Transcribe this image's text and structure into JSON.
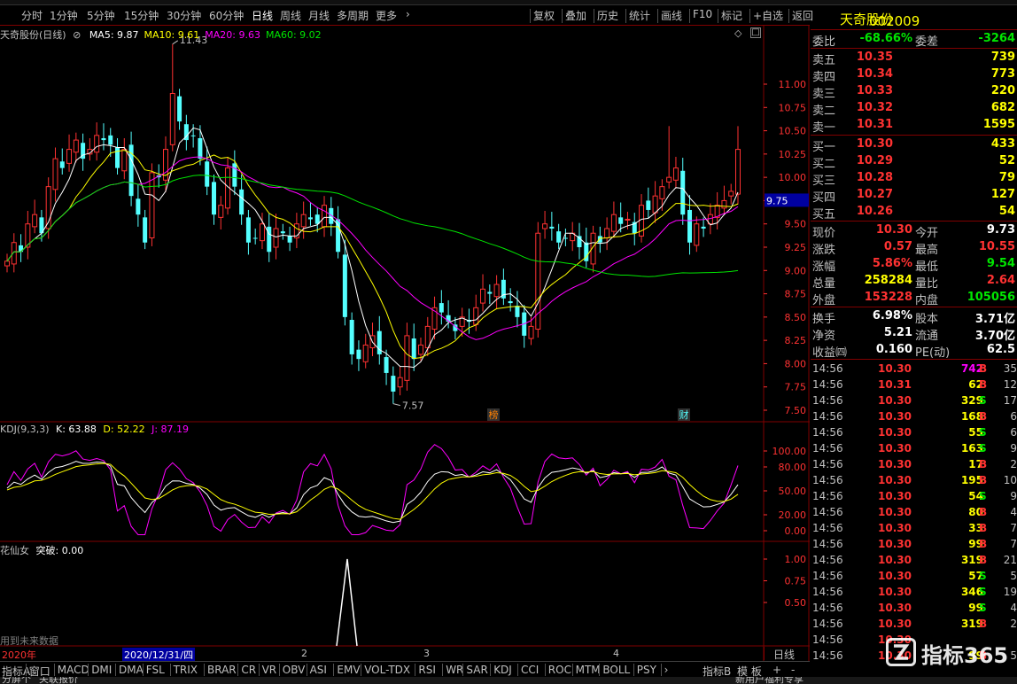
{
  "toolbar": {
    "periods": [
      "分时",
      "1分钟",
      "5分钟",
      "15分钟",
      "30分钟",
      "60分钟",
      "日线",
      "周线",
      "月线",
      "多周期",
      "更多"
    ],
    "active": "日线",
    "actions": [
      "复权",
      "叠加",
      "历史",
      "统计",
      "画线",
      "F10",
      "标记",
      "+自选",
      "返回"
    ]
  },
  "stock": {
    "code": "002009",
    "name": "天奇股份"
  },
  "main_chart": {
    "title": "天奇股份(日线)",
    "ma": [
      {
        "label": "MA5: 9.87",
        "color": "#ffffff"
      },
      {
        "label": "MA10: 9.61",
        "color": "#ffff00"
      },
      {
        "label": "MA20: 9.63",
        "color": "#ff00ff"
      },
      {
        "label": "MA60: 9.02",
        "color": "#00e600"
      }
    ],
    "high_label": "11.43",
    "low_label": "7.57",
    "current_price_tag": "9.75",
    "markers": [
      "榜",
      "财"
    ],
    "y_ticks": [
      "11.00",
      "10.75",
      "10.50",
      "10.25",
      "10.00",
      "9.75",
      "9.50",
      "9.25",
      "9.00",
      "8.75",
      "8.50",
      "8.25",
      "8.00",
      "7.75",
      "7.50"
    ]
  },
  "kdj": {
    "title": "KDJ(9,3,3)",
    "k": "K: 63.88",
    "d": "D: 52.22",
    "j": "J: 87.19",
    "y_ticks": [
      "100.00",
      "80.00",
      "50.00",
      "20.00",
      "0.00"
    ]
  },
  "hxn": {
    "title": "花仙女",
    "value": "突破: 0.00",
    "y_ticks": [
      "1.00",
      "0.75",
      "0.50"
    ],
    "note": "用到未来数据"
  },
  "date_axis": {
    "year": "2020年",
    "cursor_date": "2020/12/31/四",
    "months": [
      "2",
      "3",
      "4"
    ],
    "period": "日线"
  },
  "indicator_tabs": [
    "指标A",
    "窗口",
    "MACD",
    "DMI",
    "DMA",
    "FSL",
    "TRIX",
    "BRAR",
    "CR",
    "VR",
    "OBV",
    "ASI",
    "EMV",
    "VOL-TDX",
    "RSI",
    "WR",
    "SAR",
    "KDJ",
    "CCI",
    "ROC",
    "MTM",
    "BOLL",
    "PSY"
  ],
  "bottom_right_tabs": [
    "指标B",
    "模 板",
    "+",
    "-"
  ],
  "status_left": [
    "分屏个",
    "关联报价"
  ],
  "status_right": "新用户福利专享",
  "quote": {
    "weibi": {
      "label": "委比",
      "value": "-68.66%",
      "label2": "委差",
      "value2": "-3264"
    },
    "sell": [
      {
        "label": "卖五",
        "price": "10.35",
        "vol": "739"
      },
      {
        "label": "卖四",
        "price": "10.34",
        "vol": "773"
      },
      {
        "label": "卖三",
        "price": "10.33",
        "vol": "220"
      },
      {
        "label": "卖二",
        "price": "10.32",
        "vol": "682"
      },
      {
        "label": "卖一",
        "price": "10.31",
        "vol": "1595"
      }
    ],
    "buy": [
      {
        "label": "买一",
        "price": "10.30",
        "vol": "433"
      },
      {
        "label": "买二",
        "price": "10.29",
        "vol": "52"
      },
      {
        "label": "买三",
        "price": "10.28",
        "vol": "79"
      },
      {
        "label": "买四",
        "price": "10.27",
        "vol": "127"
      },
      {
        "label": "买五",
        "price": "10.26",
        "vol": "54"
      }
    ],
    "stats1": [
      {
        "l1": "现价",
        "v1": "10.30",
        "c1": "red",
        "l2": "今开",
        "v2": "9.73",
        "c2": "white"
      },
      {
        "l1": "涨跌",
        "v1": "0.57",
        "c1": "red",
        "l2": "最高",
        "v2": "10.55",
        "c2": "red"
      },
      {
        "l1": "涨幅",
        "v1": "5.86%",
        "c1": "red",
        "l2": "最低",
        "v2": "9.54",
        "c2": "green"
      },
      {
        "l1": "总量",
        "v1": "258284",
        "c1": "yellow",
        "l2": "量比",
        "v2": "2.64",
        "c2": "red"
      },
      {
        "l1": "外盘",
        "v1": "153228",
        "c1": "red",
        "l2": "内盘",
        "v2": "105056",
        "c2": "green"
      }
    ],
    "stats2": [
      {
        "l1": "换手",
        "v1": "6.98%",
        "l2": "股本",
        "v2": "3.71亿"
      },
      {
        "l1": "净资",
        "v1": "5.21",
        "l2": "流通",
        "v2": "3.70亿"
      },
      {
        "l1": "收益㈣",
        "v1": "0.160",
        "l2": "PE(动)",
        "v2": "62.5"
      }
    ],
    "ticks": [
      {
        "t": "14:56",
        "p": "10.30",
        "pc": "red",
        "q": "742",
        "qc": "purple",
        "bs": "B",
        "n": "35"
      },
      {
        "t": "14:56",
        "p": "10.31",
        "pc": "red",
        "q": "62",
        "qc": "yellow",
        "bs": "B",
        "n": "12"
      },
      {
        "t": "14:56",
        "p": "10.30",
        "pc": "red",
        "q": "329",
        "qc": "yellow",
        "bs": "S",
        "n": "17"
      },
      {
        "t": "14:56",
        "p": "10.30",
        "pc": "red",
        "q": "168",
        "qc": "yellow",
        "bs": "B",
        "n": "6"
      },
      {
        "t": "14:56",
        "p": "10.30",
        "pc": "red",
        "q": "55",
        "qc": "yellow",
        "bs": "S",
        "n": "6"
      },
      {
        "t": "14:56",
        "p": "10.30",
        "pc": "red",
        "q": "163",
        "qc": "yellow",
        "bs": "S",
        "n": "9"
      },
      {
        "t": "14:56",
        "p": "10.30",
        "pc": "red",
        "q": "17",
        "qc": "yellow",
        "bs": "B",
        "n": "2"
      },
      {
        "t": "14:56",
        "p": "10.30",
        "pc": "red",
        "q": "195",
        "qc": "yellow",
        "bs": "B",
        "n": "10"
      },
      {
        "t": "14:56",
        "p": "10.30",
        "pc": "red",
        "q": "54",
        "qc": "yellow",
        "bs": "S",
        "n": "9"
      },
      {
        "t": "14:56",
        "p": "10.30",
        "pc": "red",
        "q": "80",
        "qc": "yellow",
        "bs": "B",
        "n": "4"
      },
      {
        "t": "14:56",
        "p": "10.30",
        "pc": "red",
        "q": "33",
        "qc": "yellow",
        "bs": "B",
        "n": "7"
      },
      {
        "t": "14:56",
        "p": "10.30",
        "pc": "red",
        "q": "99",
        "qc": "yellow",
        "bs": "B",
        "n": "7"
      },
      {
        "t": "14:56",
        "p": "10.30",
        "pc": "red",
        "q": "319",
        "qc": "yellow",
        "bs": "B",
        "n": "21"
      },
      {
        "t": "14:56",
        "p": "10.30",
        "pc": "red",
        "q": "57",
        "qc": "yellow",
        "bs": "S",
        "n": "5"
      },
      {
        "t": "14:56",
        "p": "10.30",
        "pc": "red",
        "q": "346",
        "qc": "yellow",
        "bs": "S",
        "n": "19"
      },
      {
        "t": "14:56",
        "p": "10.30",
        "pc": "red",
        "q": "99",
        "qc": "yellow",
        "bs": "S",
        "n": "4"
      },
      {
        "t": "14:56",
        "p": "10.30",
        "pc": "red",
        "q": "319",
        "qc": "yellow",
        "bs": "B",
        "n": "2"
      },
      {
        "t": "14:56",
        "p": "10.30",
        "pc": "red",
        "q": "",
        "qc": "yellow",
        "bs": "",
        "n": ""
      },
      {
        "t": "14:56",
        "p": "10.30",
        "pc": "red",
        "q": "99",
        "qc": "yellow",
        "bs": "B",
        "n": "5"
      }
    ]
  },
  "watermark": {
    "text": "指标365"
  },
  "colors": {
    "up": "#ff3232",
    "down": "#54ffff",
    "grid": "#800000",
    "axis_text": "#ff3232"
  }
}
